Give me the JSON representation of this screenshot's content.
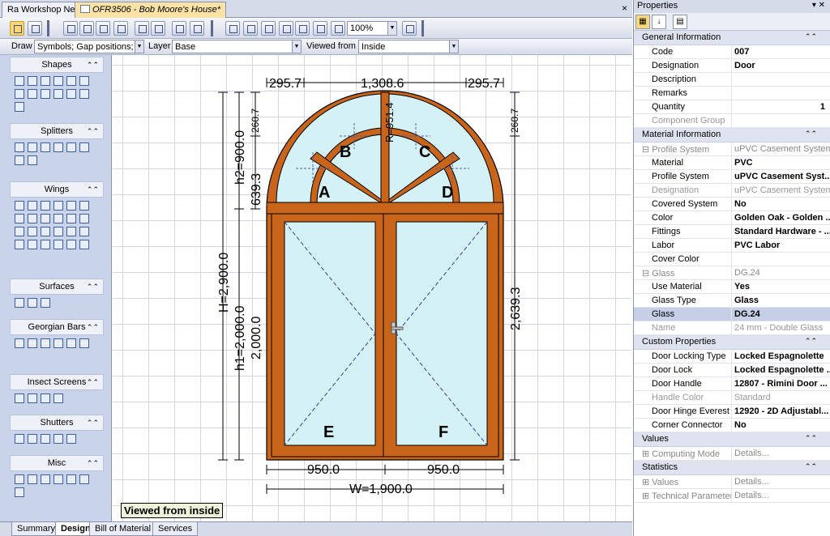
{
  "tabs": [
    {
      "label": "Ra Workshop News"
    },
    {
      "label": "OFR3506 - Bob Moore's House*"
    }
  ],
  "close_label": "×",
  "zoom": "100%",
  "toolbar2": {
    "draw_label": "Draw",
    "draw_value": "Symbols; Gap positions; ...",
    "layer_label": "Layer",
    "layer_value": "Base",
    "viewed_label": "Viewed from",
    "viewed_value": "Inside"
  },
  "left_sections": [
    {
      "title": "Shapes",
      "count": 13
    },
    {
      "title": "Splitters",
      "count": 8
    },
    {
      "title": "Wings",
      "count": 24
    },
    {
      "title": "Surfaces",
      "count": 3
    },
    {
      "title": "Georgian Bars",
      "count": 6
    },
    {
      "title": "Insect Screens",
      "count": 4
    },
    {
      "title": "Shutters",
      "count": 5
    },
    {
      "title": "Misc",
      "count": 7
    }
  ],
  "drawing": {
    "dims_top": [
      "295.7",
      "1,308.6",
      "295.7"
    ],
    "dims_left": [
      "h2=900.0",
      "639.3",
      "260.7",
      "H=2,900.0",
      "h1=2,000.0",
      "2,000.0"
    ],
    "dims_right": [
      "260.7",
      "2,639.3"
    ],
    "dims_bottom": [
      "950.0",
      "950.0",
      "W=1,900.0"
    ],
    "radius": "R=951.4",
    "panels": [
      "A",
      "B",
      "C",
      "D",
      "E",
      "F"
    ],
    "view_label": "Viewed from inside",
    "frame_color": "#c8651a",
    "glass_color": "#d4f1f5"
  },
  "bottom_tabs": [
    "Summary",
    "Design",
    "Bill of Material",
    "Services"
  ],
  "properties": {
    "title": "Properties",
    "pin": "▾ ✕",
    "categories": [
      {
        "name": "General Information",
        "rows": [
          {
            "k": "Code",
            "v": "007"
          },
          {
            "k": "Designation",
            "v": "Door"
          },
          {
            "k": "Description",
            "v": ""
          },
          {
            "k": "Remarks",
            "v": ""
          },
          {
            "k": "Quantity",
            "v": "1",
            "num": true
          },
          {
            "k": "Component Group",
            "v": "",
            "dis": true
          }
        ]
      },
      {
        "name": "Material Information",
        "rows": [
          {
            "k": "⊟ Profile System",
            "v": "uPVC Casement System",
            "sub": true
          },
          {
            "k": "Material",
            "v": "PVC"
          },
          {
            "k": "Profile System",
            "v": "uPVC Casement Syst..."
          },
          {
            "k": "Designation",
            "v": "uPVC Casement System",
            "dis": true
          },
          {
            "k": "Covered System",
            "v": "No"
          },
          {
            "k": "Color",
            "v": "Golden Oak - Golden ..."
          },
          {
            "k": "Fittings",
            "v": "Standard Hardware - ..."
          },
          {
            "k": "Labor",
            "v": "PVC Labor"
          },
          {
            "k": "Cover Color",
            "v": ""
          },
          {
            "k": "⊟ Glass",
            "v": "DG.24",
            "sub": true
          },
          {
            "k": "Use Material",
            "v": "Yes"
          },
          {
            "k": "Glass Type",
            "v": "Glass"
          },
          {
            "k": "Glass",
            "v": "DG.24",
            "hl": true
          },
          {
            "k": "Name",
            "v": "24 mm - Double Glass",
            "dis": true
          }
        ]
      },
      {
        "name": "Custom Properties",
        "rows": [
          {
            "k": "Door Locking Type",
            "v": "Locked Espagnolette"
          },
          {
            "k": "Door Lock",
            "v": "Locked Espagnolette ..."
          },
          {
            "k": "Door Handle",
            "v": "12807 - Rimini Door ..."
          },
          {
            "k": "Handle Color",
            "v": "Standard",
            "dis": true
          },
          {
            "k": "Door Hinge Everest",
            "v": "12920 - 2D Adjustabl..."
          },
          {
            "k": "Corner Connector",
            "v": "No"
          }
        ]
      },
      {
        "name": "Values",
        "rows": [
          {
            "k": "⊞ Computing Mode",
            "v": "Details...",
            "sub": true
          }
        ]
      },
      {
        "name": "Statistics",
        "rows": [
          {
            "k": "⊞ Values",
            "v": "Details...",
            "sub": true
          },
          {
            "k": "⊞ Technical Parameters",
            "v": "Details...",
            "sub": true
          }
        ]
      }
    ]
  }
}
